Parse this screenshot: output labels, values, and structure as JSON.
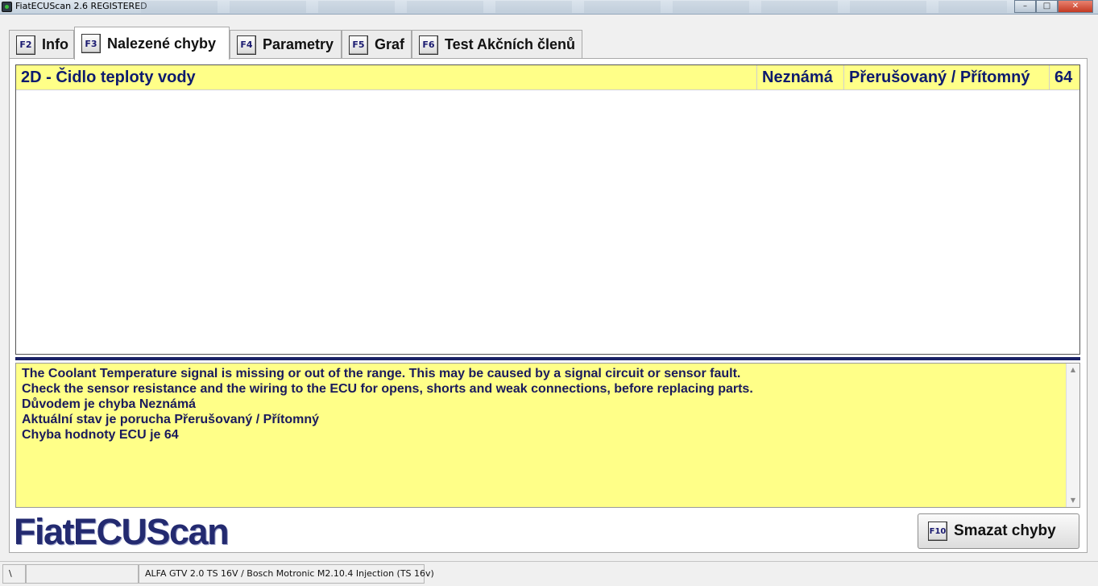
{
  "window": {
    "title": "FiatECUScan 2.6 REGISTERED",
    "minimize_glyph": "–",
    "maximize_glyph": "□",
    "close_glyph": "✕"
  },
  "tabs": [
    {
      "key": "F2",
      "label": "Info",
      "active": false
    },
    {
      "key": "F3",
      "label": "Nalezené chyby",
      "active": true
    },
    {
      "key": "F4",
      "label": "Parametry",
      "active": false
    },
    {
      "key": "F5",
      "label": "Graf",
      "active": false
    },
    {
      "key": "F6",
      "label": "Test Akčních členů",
      "active": false
    }
  ],
  "faults": [
    {
      "name": "2D - Čidlo teploty vody",
      "origin": "Neznámá",
      "status": "Přerušovaný / Přítomný",
      "code": "64"
    }
  ],
  "description": {
    "lines": [
      "The Coolant Temperature signal is missing or out of the range. This may be caused by a signal circuit or sensor fault.",
      "Check the sensor resistance and the wiring to the ECU for opens, shorts and weak connections, before replacing parts.",
      "Důvodem je chyba Neznámá",
      "Aktuální stav je porucha Přerušovaný / Přítomný",
      "Chyba hodnoty ECU je 64"
    ]
  },
  "logo_text": "FiatECUScan",
  "clear_button": {
    "key": "F10",
    "label": "Smazat chyby"
  },
  "statusbar": {
    "cell1": "\\",
    "cell2": "",
    "vehicle": "ALFA GTV 2.0 TS 16V / Bosch Motronic M2.10.4 Injection (TS 16v)"
  },
  "colors": {
    "highlight": "#ffff88",
    "brand": "#232a70",
    "divider": "#1a2266"
  }
}
